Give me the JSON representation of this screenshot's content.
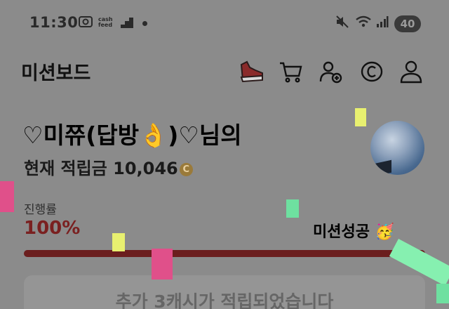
{
  "status_bar": {
    "time": "11:30",
    "app_icons": [
      "screenshot-icon",
      "cashfeed-icon",
      "stairs-icon"
    ],
    "cashfeed_line1": "cash",
    "cashfeed_line2": "feed",
    "battery": "40"
  },
  "header": {
    "title": "미션보드",
    "icons": [
      "sneaker-icon",
      "cart-icon",
      "add-friend-icon",
      "cash-coin-icon",
      "profile-icon"
    ]
  },
  "profile": {
    "name_line": "♡미쮸(답방👌)♡님의",
    "balance_prefix": "현재 적립금",
    "balance_value": "10,046",
    "coin_symbol": "C"
  },
  "progress": {
    "label": "진행률",
    "value_text": "100%",
    "fraction": 1.0,
    "status": "미션성공",
    "status_emoji": "🥳"
  },
  "toast": {
    "message": "추가 3캐시가 적립되었습니다"
  },
  "colors": {
    "overlay_bg": "#8b8b8b",
    "progress_fill": "#6b1e1e",
    "progress_text": "#7a2020",
    "confetti_yellow": "#e8f070",
    "confetti_pink": "#e0508a",
    "confetti_green": "#6ee0a0",
    "confetti_mint": "#86f0b0"
  }
}
